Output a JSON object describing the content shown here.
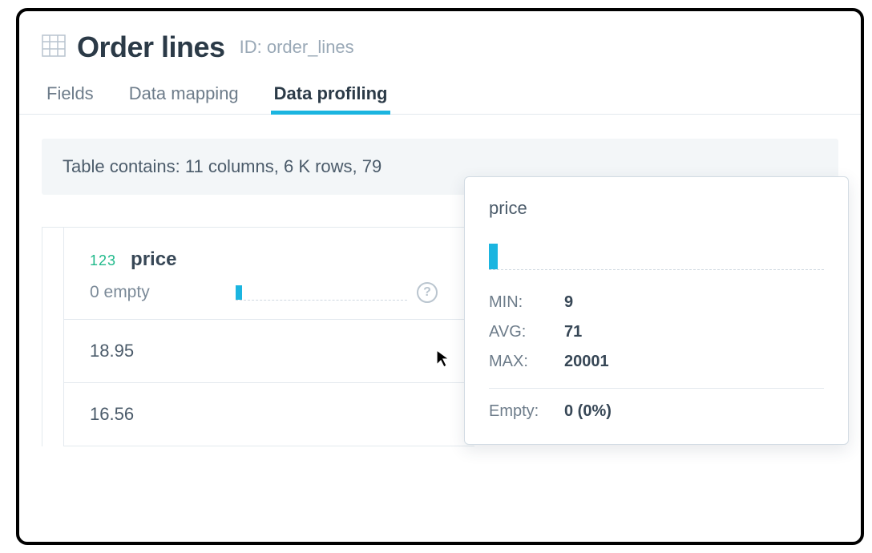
{
  "header": {
    "title": "Order lines",
    "id_prefix": "ID:",
    "id_value": "order_lines"
  },
  "tabs": {
    "fields": "Fields",
    "data_mapping": "Data mapping",
    "data_profiling": "Data profiling"
  },
  "summary": {
    "text": "Table contains: 11 columns, 6 K rows, 79"
  },
  "column": {
    "type_badge": "123",
    "name": "price",
    "empty_label": "0 empty",
    "values": [
      "18.95",
      "16.56"
    ]
  },
  "tooltip": {
    "title": "price",
    "min_label": "MIN:",
    "min_value": "9",
    "avg_label": "AVG:",
    "avg_value": "71",
    "max_label": "MAX:",
    "max_value": "20001",
    "empty_label": "Empty:",
    "empty_value": "0 (0%)"
  }
}
